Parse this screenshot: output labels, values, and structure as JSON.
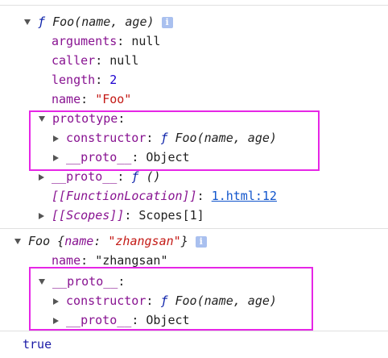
{
  "colors": {
    "highlight_box": "#e626e6",
    "key": "#881391",
    "string": "#c41a16",
    "number": "#1c00cf"
  },
  "block1": {
    "header": {
      "f": "ƒ",
      "signature": "Foo(name, age)",
      "info_icon": "i"
    },
    "arguments": {
      "key": "arguments",
      "value": "null"
    },
    "caller": {
      "key": "caller",
      "value": "null"
    },
    "length": {
      "key": "length",
      "value": "2"
    },
    "name": {
      "key": "name",
      "value": "\"Foo\""
    },
    "prototype": {
      "key": "prototype",
      "constructor": {
        "key": "constructor",
        "f": "ƒ",
        "value": "Foo(name, age)"
      },
      "proto": {
        "key": "__proto__",
        "value": "Object"
      }
    },
    "proto": {
      "key": "__proto__",
      "f": "ƒ",
      "value": "()"
    },
    "function_location": {
      "key": "[[FunctionLocation]]",
      "value": "1.html:12"
    },
    "scopes": {
      "key": "[[Scopes]]",
      "value": "Scopes[1]"
    }
  },
  "block2": {
    "header": {
      "type": "Foo",
      "open_brace": "{",
      "key": "name",
      "value": "\"zhangsan\"",
      "close_brace": "}",
      "info_icon": "i"
    },
    "name": {
      "key": "name",
      "value": "\"zhangsan\""
    },
    "proto": {
      "key": "__proto__",
      "constructor": {
        "key": "constructor",
        "f": "ƒ",
        "value": "Foo(name, age)"
      },
      "proto": {
        "key": "__proto__",
        "value": "Object"
      }
    }
  },
  "result": "true"
}
